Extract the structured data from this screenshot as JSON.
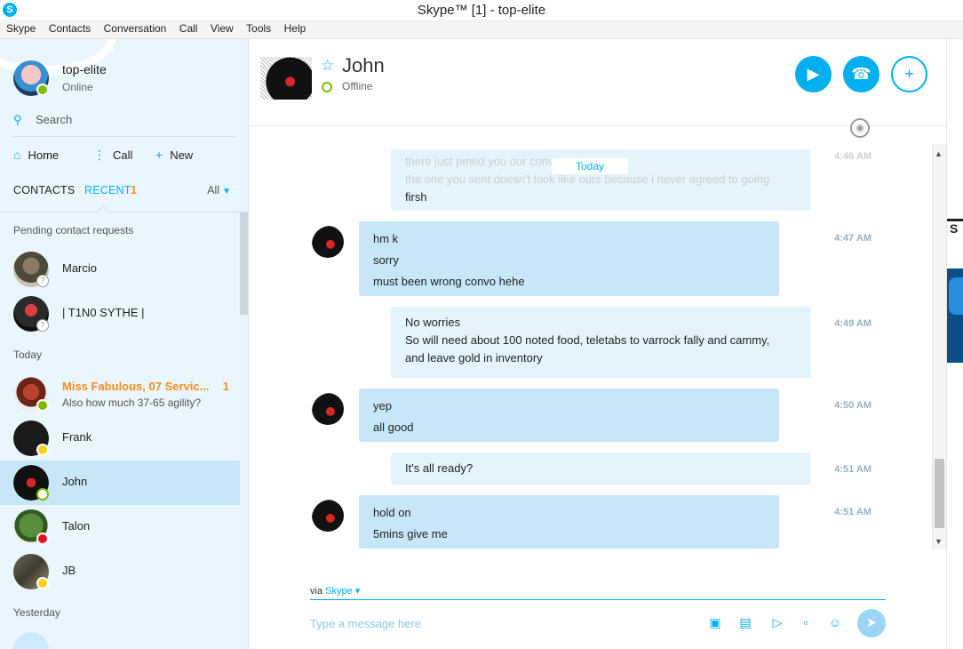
{
  "window": {
    "title": "Skype™ [1] - top-elite",
    "icon": "skype-logo-icon"
  },
  "menu": [
    "Skype",
    "Contacts",
    "Conversation",
    "Call",
    "View",
    "Tools",
    "Help"
  ],
  "profile": {
    "name": "top-elite",
    "status": "Online"
  },
  "search": {
    "label": "Search"
  },
  "nav": {
    "home": "Home",
    "call": "Call",
    "new": "New"
  },
  "tabs": {
    "contacts": "CONTACTS",
    "recent": "RECENT",
    "recent_count": "1",
    "filter": "All"
  },
  "sections": {
    "pending": "Pending contact requests",
    "today": "Today",
    "yesterday": "Yesterday"
  },
  "contacts": [
    {
      "name": "Marcio",
      "status": "pending"
    },
    {
      "name": "| T1N0 SYTHE |",
      "status": "pending"
    },
    {
      "name": "Miss Fabulous, 07 Servic...",
      "snippet": "Also how much 37-65 agility?",
      "unread": "1",
      "status": "online"
    },
    {
      "name": "Frank",
      "status": "away"
    },
    {
      "name": "John",
      "status": "offline",
      "selected": true
    },
    {
      "name": "Talon",
      "status": "do-not-disturb"
    },
    {
      "name": "JB",
      "status": "away"
    }
  ],
  "chat": {
    "name": "John",
    "status": "Offline"
  },
  "header_buttons": {
    "video": "video-call-icon",
    "call": "phone-icon",
    "add": "add-contact-icon"
  },
  "messages": {
    "day_label": "Today",
    "faded_line_1": "there just pmed you our convo...",
    "faded_line_2": "the one you sent doesn't look like ours because i never agreed to going",
    "faded_tail": "firsh",
    "m1": {
      "lines": [
        "hm k",
        "sorry",
        "must been wrong convo hehe"
      ],
      "time": "4:47 AM"
    },
    "m2": {
      "lines": [
        "No worries",
        "So will need about 100 noted food, teletabs to varrock fally and cammy,",
        "and leave gold in inventory"
      ],
      "time": "4:49 AM"
    },
    "m3": {
      "lines": [
        "yep",
        "all good"
      ],
      "time": "4:50 AM"
    },
    "m4": {
      "lines": [
        "It's all ready?"
      ],
      "time": "4:51 AM"
    },
    "m5": {
      "lines": [
        "hold on",
        "5mins give me"
      ],
      "time": "4:51 AM"
    },
    "faded_time": "4:46 AM"
  },
  "compose": {
    "via": "via",
    "via_service": "Skype",
    "placeholder": "Type a message here"
  },
  "compose_tools": [
    "send-photo-icon",
    "send-file-icon",
    "video-message-icon",
    "send-contacts-icon",
    "emoticon-icon",
    "send-icon"
  ],
  "colors": {
    "accent": "#00aff0",
    "unread": "#f68d1e",
    "online": "#7fba00",
    "away": "#fcd116",
    "dnd": "#e81123"
  }
}
